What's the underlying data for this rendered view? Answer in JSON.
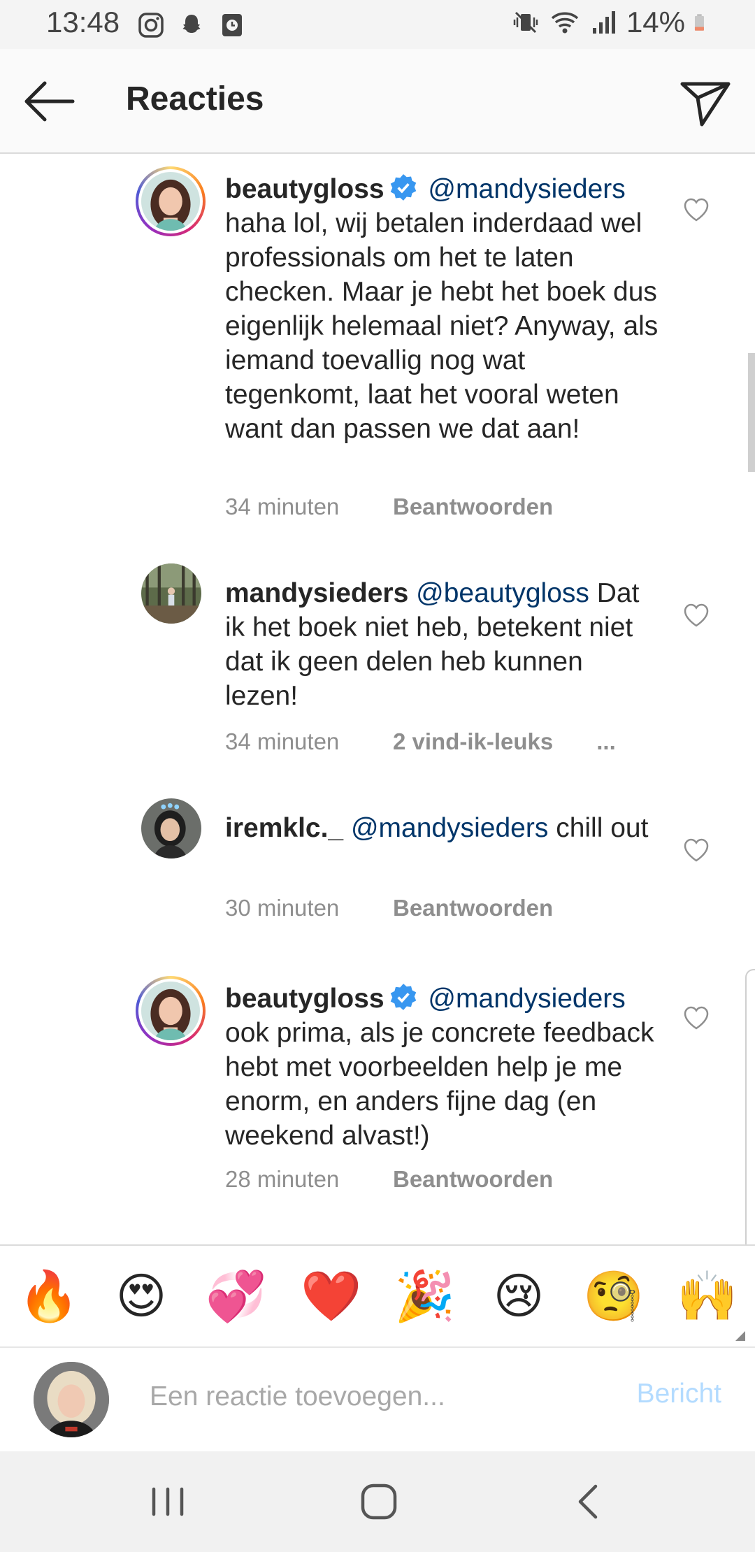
{
  "status_bar": {
    "time": "13:48",
    "left_icons": [
      "instagram-icon",
      "snapchat-icon",
      "clock-app-icon"
    ],
    "right_icons": [
      "mute-vibrate-icon",
      "wifi-icon",
      "signal-icon",
      "battery-icon"
    ],
    "battery": "14%"
  },
  "header": {
    "title": "Reacties",
    "back_icon": "arrow-left-icon",
    "share_icon": "paper-plane-icon"
  },
  "comments": [
    {
      "username": "beautygloss",
      "verified": true,
      "mention": "@mandysieders",
      "text": "haha lol, wij betalen inderdaad wel professionals om het te laten checken. Maar je hebt het boek dus eigenlijk helemaal niet? Anyway, als iemand toevallig nog wat tegenkomt, laat het vooral weten want dan passen we dat aan!",
      "time": "34 minuten",
      "action": "Beantwoorden",
      "more": ""
    },
    {
      "username": "mandysieders",
      "verified": false,
      "mention": "@beautygloss",
      "text": "Dat ik het boek niet heb, betekent niet dat ik geen delen heb kunnen lezen!",
      "time": "34 minuten",
      "action": "2 vind-ik-leuks",
      "more": "..."
    },
    {
      "username": "iremklc._",
      "verified": false,
      "mention": "@mandysieders",
      "text": "chill out",
      "time": "30 minuten",
      "action": "Beantwoorden",
      "more": ""
    },
    {
      "username": "beautygloss",
      "verified": true,
      "mention": "@mandysieders",
      "text": "ook prima, als je concrete feedback hebt met voorbeelden help je me enorm, en anders fijne dag (en weekend alvast!)",
      "time": "28 minuten",
      "action": "Beantwoorden",
      "more": ""
    }
  ],
  "emoji_bar": [
    "🔥",
    "😍",
    "💞",
    "❤️",
    "🎉",
    "😢",
    "🧐",
    "🙌"
  ],
  "input": {
    "placeholder": "Een reactie toevoegen...",
    "post_label": "Bericht"
  },
  "nav_bar": {
    "icons": [
      "recent-apps-icon",
      "home-icon",
      "back-icon"
    ]
  },
  "colors": {
    "mention": "#003569",
    "meta": "#8e8e8e",
    "post_disabled": "#b3dbff",
    "verified": "#3897f0"
  }
}
